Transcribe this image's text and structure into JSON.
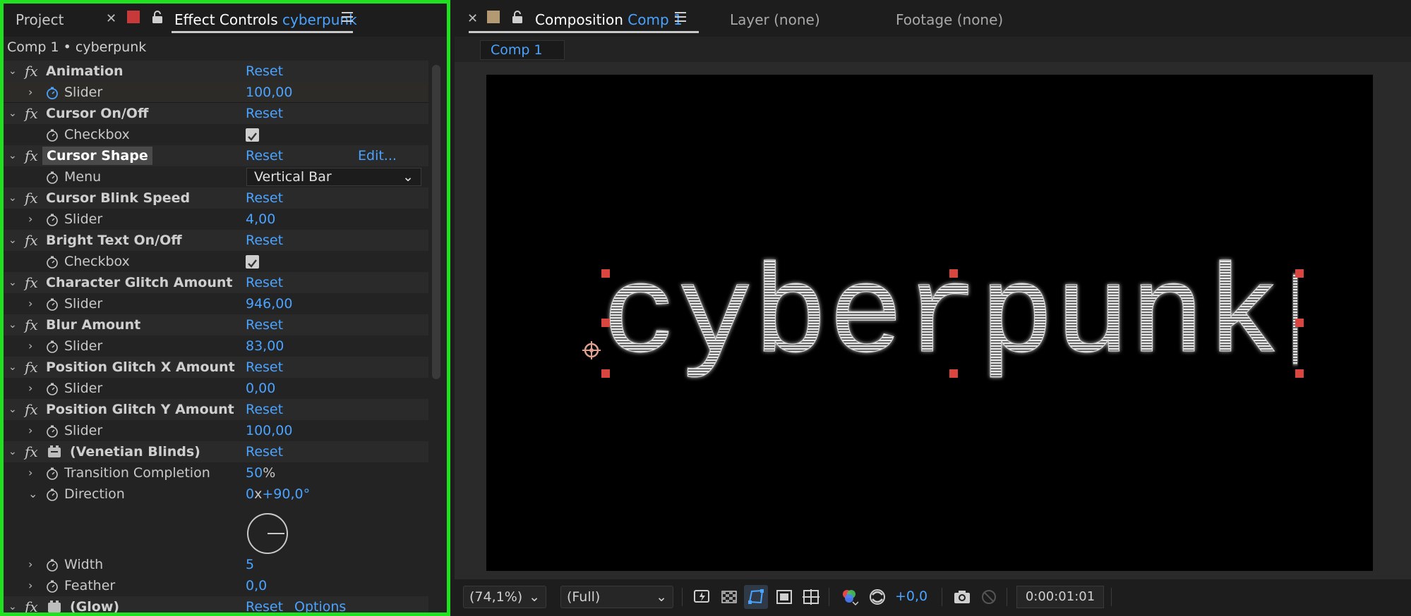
{
  "left_panel": {
    "tabs": {
      "project": "Project",
      "effect_controls": "Effect Controls",
      "effect_controls_target": "cyberpunk"
    },
    "comp_label": "Comp 1 • cyberpunk",
    "reset": "Reset",
    "edit": "Edit...",
    "options": "Options",
    "effects": {
      "animation": {
        "name": "Animation",
        "param": "Slider",
        "value": "100,00"
      },
      "cursor_onoff": {
        "name": "Cursor On/Off",
        "param": "Checkbox"
      },
      "cursor_shape": {
        "name": "Cursor Shape",
        "param": "Menu",
        "value": "Vertical Bar"
      },
      "cursor_blink": {
        "name": "Cursor Blink Speed",
        "param": "Slider",
        "value": "4,00"
      },
      "bright_text": {
        "name": "Bright Text On/Off",
        "param": "Checkbox"
      },
      "char_glitch": {
        "name": "Character Glitch Amount",
        "param": "Slider",
        "value": "946,00"
      },
      "blur": {
        "name": "Blur Amount",
        "param": "Slider",
        "value": "83,00"
      },
      "pos_glitch_x": {
        "name": "Position Glitch X Amount",
        "param": "Slider",
        "value": "0,00"
      },
      "pos_glitch_y": {
        "name": "Position Glitch Y Amount",
        "param": "Slider",
        "value": "100,00"
      },
      "venetian": {
        "name": "(Venetian Blinds)",
        "transition_label": "Transition Completion",
        "transition_value": "50",
        "transition_unit": "%",
        "direction_label": "Direction",
        "direction_rev": "0",
        "direction_x": "x",
        "direction_deg": "+90,0°",
        "width_label": "Width",
        "width_value": "5",
        "feather_label": "Feather",
        "feather_value": "0,0"
      },
      "glow": {
        "name": "(Glow)"
      }
    }
  },
  "right_panel": {
    "tabs": {
      "composition": "Composition",
      "composition_target": "Comp 1",
      "layer": "Layer (none)",
      "footage": "Footage (none)"
    },
    "comp_chip": "Comp 1",
    "canvas_text": "cyberpunk",
    "footer": {
      "zoom": "(74,1%)",
      "resolution": "(Full)",
      "exposure": "+0,0",
      "timecode": "0:00:01:01"
    }
  },
  "colors": {
    "accent": "#4aa3ff",
    "highlight_outline": "#21e021",
    "handle": "#d9453f"
  }
}
